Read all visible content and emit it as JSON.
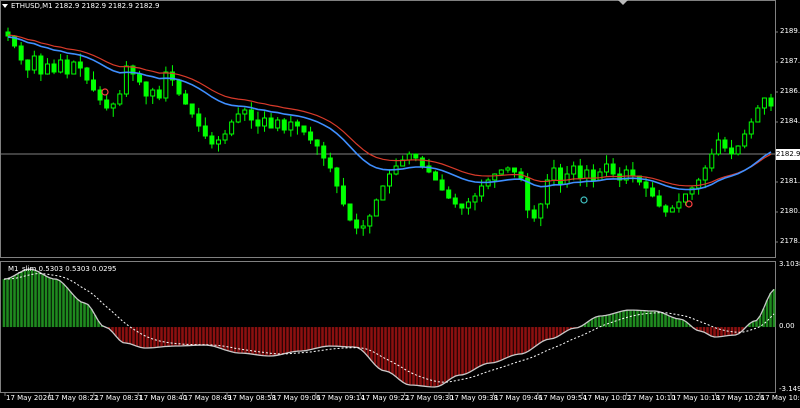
{
  "main": {
    "title": "ETHUSD,M1  2182.9 2182.9 2182.9 2182.9",
    "current_price_label": "2182.9",
    "price_ticks": [
      {
        "value": 2189.0,
        "label": "2189.0"
      },
      {
        "value": 2187.5,
        "label": "2187.5"
      },
      {
        "value": 2186.0,
        "label": "2186.0"
      },
      {
        "value": 2184.5,
        "label": "2184.5"
      },
      {
        "value": 2181.5,
        "label": "2181.5"
      },
      {
        "value": 2180.0,
        "label": "2180.0"
      },
      {
        "value": 2178.5,
        "label": "2178.5"
      }
    ],
    "current_price": 2182.9,
    "y_range": [
      2177.75,
      2190.3
    ]
  },
  "indicator": {
    "title": "M1_slim  0.5303 0.5303 0.0295",
    "ticks": [
      {
        "value": 3.1038,
        "label": "3.1038"
      },
      {
        "value": 0.0,
        "label": "0.00"
      },
      {
        "value": -3.1499,
        "label": "-3.1499"
      }
    ],
    "y_range": [
      -3.1499,
      3.1038
    ]
  },
  "time_axis": [
    "17 May 2026",
    "17 May 08:22",
    "17 May 08:31",
    "17 May 08:40",
    "17 May 08:49",
    "17 May 08:58",
    "17 May 09:06",
    "17 May 09:14",
    "17 May 09:22",
    "17 May 09:30",
    "17 May 09:38",
    "17 May 09:46",
    "17 May 09:54",
    "17 May 10:02",
    "17 May 10:10",
    "17 May 10:18",
    "17 May 10:26",
    "17 May 10:34"
  ],
  "colors": {
    "background": "#000000",
    "candle": "#00ff00",
    "ma_red": "#d83a2a",
    "ma_blue": "#3f8fff",
    "hist_positive": "#1f8a1f",
    "hist_negative": "#8b1010",
    "osc_line": "#c8c8c8",
    "signal_line": "#ffffff",
    "grid": "#808080"
  },
  "chart_data": [
    {
      "type": "candlestick",
      "title": "ETHUSD,M1  2182.9 2182.9 2182.9 2182.9",
      "ylim": [
        2177.75,
        2190.3
      ],
      "close_series": [
        2188.8,
        2188.3,
        2187.6,
        2187.1,
        2187.8,
        2186.9,
        2187.4,
        2187.0,
        2187.6,
        2186.9,
        2187.5,
        2187.2,
        2186.6,
        2186.1,
        2185.6,
        2185.2,
        2185.4,
        2185.9,
        2187.3,
        2186.9,
        2186.5,
        2185.8,
        2186.1,
        2185.7,
        2187.0,
        2186.6,
        2185.9,
        2185.4,
        2184.9,
        2184.3,
        2183.8,
        2183.4,
        2183.6,
        2183.9,
        2184.5,
        2184.9,
        2185.1,
        2184.6,
        2184.3,
        2184.7,
        2184.2,
        2184.6,
        2184.1,
        2184.5,
        2184.3,
        2184.0,
        2183.6,
        2183.3,
        2182.7,
        2182.2,
        2181.3,
        2180.4,
        2179.6,
        2179.2,
        2179.3,
        2179.8,
        2180.6,
        2181.3,
        2181.9,
        2182.3,
        2182.6,
        2182.9,
        2182.7,
        2182.3,
        2182.0,
        2181.6,
        2181.1,
        2180.7,
        2180.4,
        2180.2,
        2180.5,
        2180.8,
        2181.3,
        2181.6,
        2181.9,
        2182.1,
        2182.2,
        2182.0,
        2181.7,
        2180.1,
        2179.7,
        2180.4,
        2181.6,
        2182.2,
        2181.4,
        2181.9,
        2182.3,
        2181.7,
        2182.1,
        2181.6,
        2182.0,
        2182.4,
        2181.9,
        2181.6,
        2182.1,
        2181.8,
        2181.5,
        2181.2,
        2180.8,
        2180.3,
        2180.0,
        2180.2,
        2180.5,
        2180.9,
        2181.2,
        2181.6,
        2182.2,
        2182.9,
        2183.6,
        2183.2,
        2182.9,
        2183.3,
        2183.9,
        2184.5,
        2185.2,
        2185.7,
        2185.3
      ]
    },
    {
      "type": "histogram",
      "title": "M1_slim  0.5303 0.5303 0.0295",
      "ylim": [
        -3.1499,
        3.1038
      ],
      "description_values": "oscillator goes from +2.9 to 0 around 08:28, min -1.0 near 08:40, -1.4 near 09:00, -3.0 near 09:30, back to 0 around 09:58, +0.8 near 10:04, -0.5 near 10:20, +1.9 at end"
    }
  ]
}
